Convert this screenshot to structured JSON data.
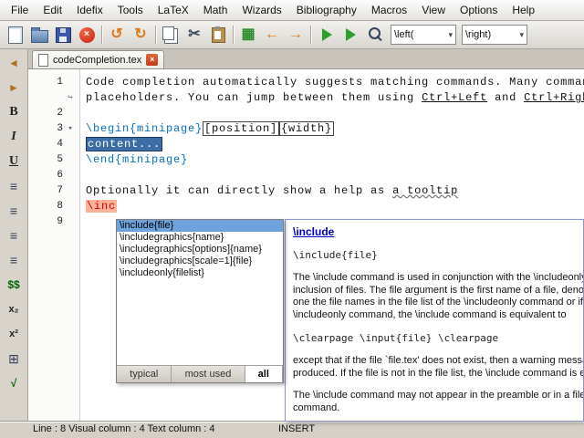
{
  "menu": {
    "items": [
      "File",
      "Edit",
      "Idefix",
      "Tools",
      "LaTeX",
      "Math",
      "Wizards",
      "Bibliography",
      "Macros",
      "View",
      "Options",
      "Help"
    ]
  },
  "toolbar": {
    "buttons": [
      {
        "name": "new-file-button",
        "icon": "new-file-icon",
        "shape": "doc"
      },
      {
        "name": "open-file-button",
        "icon": "open-folder-icon",
        "shape": "folder"
      },
      {
        "name": "save-file-button",
        "icon": "save-icon",
        "shape": "floppy"
      },
      {
        "name": "close-file-button",
        "icon": "close-circle-icon",
        "shape": "closex"
      },
      {
        "name": "separator"
      },
      {
        "name": "undo-button",
        "icon": "undo-icon",
        "glyph": "↺",
        "color": "#e07818"
      },
      {
        "name": "redo-button",
        "icon": "redo-icon",
        "glyph": "↻",
        "color": "#e07818"
      },
      {
        "name": "separator"
      },
      {
        "name": "copy-button",
        "icon": "copy-icon",
        "shape": "copy"
      },
      {
        "name": "cut-button",
        "icon": "scissors-icon",
        "glyph": "✂",
        "color": "#3c4a5a"
      },
      {
        "name": "paste-button",
        "icon": "paste-icon",
        "shape": "paste"
      },
      {
        "name": "separator"
      },
      {
        "name": "messages-log-button",
        "icon": "log-panel-icon",
        "glyph": "▦",
        "color": "#2e8b2e"
      },
      {
        "name": "back-button",
        "icon": "back-arrow-icon",
        "glyph": "←",
        "color": "#e07818"
      },
      {
        "name": "forward-button",
        "icon": "forward-arrow-icon",
        "glyph": "→",
        "color": "#e07818"
      },
      {
        "name": "separator"
      },
      {
        "name": "quick-build-button",
        "icon": "play-icon",
        "shape": "play"
      },
      {
        "name": "compile-button",
        "icon": "play-icon",
        "shape": "play"
      },
      {
        "name": "view-pdf-button",
        "icon": "magnifier-icon",
        "shape": "magnifier"
      }
    ],
    "left_combo": "\\left(",
    "right_combo": "\\right)"
  },
  "sidebar": {
    "buttons": [
      {
        "name": "collapse-panel-button",
        "icon": "left-arrow-icon",
        "glyph": "◄",
        "cls": "arrow"
      },
      {
        "name": "expand-panel-button",
        "icon": "right-arrow-icon",
        "glyph": "►",
        "cls": "arrow"
      },
      {
        "name": "bold-button",
        "icon": "bold-icon",
        "glyph": "B",
        "cls": "serif"
      },
      {
        "name": "italic-button",
        "icon": "italic-icon",
        "glyph": "I",
        "cls": "serif italic"
      },
      {
        "name": "underline-button",
        "icon": "underline-icon",
        "glyph": "U",
        "cls": "serif under"
      },
      {
        "name": "itemize-button",
        "icon": "bullet-list-icon",
        "glyph": "≡",
        "cls": "list"
      },
      {
        "name": "enumerate-button",
        "icon": "numbered-list-icon",
        "glyph": "≡",
        "cls": "list"
      },
      {
        "name": "description-button",
        "icon": "description-list-icon",
        "glyph": "≡",
        "cls": "list"
      },
      {
        "name": "environment-button",
        "icon": "block-icon",
        "glyph": "≡",
        "cls": "list"
      },
      {
        "name": "inline-math-button",
        "icon": "dollar-math-icon",
        "glyph": "$$",
        "cls": "math"
      },
      {
        "name": "subscript-button",
        "icon": "subscript-icon",
        "glyph": "x₂",
        "cls": "script"
      },
      {
        "name": "superscript-button",
        "icon": "superscript-icon",
        "glyph": "x²",
        "cls": "script"
      },
      {
        "name": "matrix-button",
        "icon": "matrix-icon",
        "glyph": "⊞",
        "cls": "list"
      },
      {
        "name": "sqrt-button",
        "icon": "sqrt-icon",
        "glyph": "√",
        "cls": "math"
      }
    ]
  },
  "tab": {
    "label": "codeCompletion.tex"
  },
  "editor": {
    "rows": [
      {
        "num": "1",
        "marker": "",
        "segs": [
          {
            "t": "Code completion automatically suggests matching commands. Many commands have",
            "c": ""
          }
        ]
      },
      {
        "num": "",
        "marker": "wrap",
        "segs": [
          {
            "t": "placeholders. You can jump between them using ",
            "c": ""
          },
          {
            "t": "Ctrl+Left",
            "c": "ul"
          },
          {
            "t": " and ",
            "c": ""
          },
          {
            "t": "Ctrl+Right",
            "c": "ul"
          },
          {
            "t": ".",
            "c": ""
          }
        ]
      },
      {
        "num": "2",
        "marker": "",
        "segs": []
      },
      {
        "num": "3",
        "marker": "fold",
        "segs": [
          {
            "t": "\\begin{minipage}",
            "c": "cmd"
          },
          {
            "t": "[position]",
            "c": "box"
          },
          {
            "t": "{width}",
            "c": "box"
          }
        ]
      },
      {
        "num": "4",
        "marker": "",
        "segs": [
          {
            "t": "content...",
            "c": "sel"
          }
        ]
      },
      {
        "num": "5",
        "marker": "",
        "segs": [
          {
            "t": "\\end{minipage}",
            "c": "cmd"
          }
        ]
      },
      {
        "num": "6",
        "marker": "",
        "segs": []
      },
      {
        "num": "7",
        "marker": "",
        "segs": [
          {
            "t": "Optionally it can directly show a help as ",
            "c": ""
          },
          {
            "t": "a tooltip",
            "c": "wavy"
          }
        ]
      },
      {
        "num": "8",
        "marker": "",
        "segs": [
          {
            "t": "\\inc",
            "c": "err"
          }
        ]
      },
      {
        "num": "9",
        "marker": "",
        "segs": []
      }
    ]
  },
  "popup": {
    "items": [
      "\\include{file}",
      "\\includegraphics{name}",
      "\\includegraphics[options]{name}",
      "\\includegraphics[scale=1]{file}",
      "\\includeonly{filelist}"
    ],
    "selected_index": 0,
    "tabs": [
      "typical",
      "most used",
      "all"
    ],
    "active_tab": "all"
  },
  "help": {
    "title": "\\include",
    "code_top": "\\include{file}",
    "para1": [
      "The \\include command is used in conjunction with the \\includeonly command for selective",
      "inclusion of files. The file argument is the first name of a file, denoting `file.tex'. If file is",
      "one the file names in the file list of the \\includeonly command or if there is no",
      "\\includeonly command, the \\include command is equivalent to"
    ],
    "code_mid": "\\clearpage \\input{file} \\clearpage",
    "para2": [
      "except that if the file `file.tex' does not exist, then a warning message rather than an error is",
      "produced. If the file is not in the file list, the \\include command is equivalent to \\clearpage."
    ],
    "para3": [
      "The \\include command may not appear in the preamble or in a file read by another \\include",
      "command."
    ]
  },
  "status": {
    "left": "Line : 8 Visual column : 4 Text column : 4",
    "mode": "INSERT"
  }
}
